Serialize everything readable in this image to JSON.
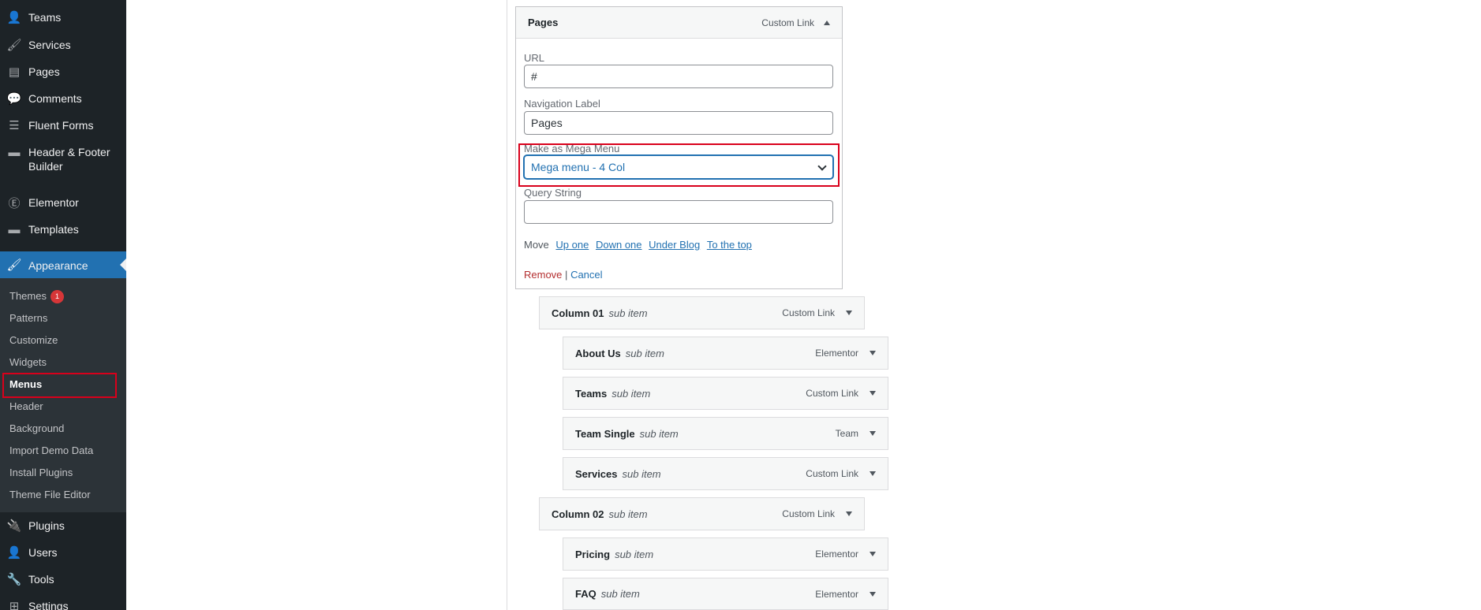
{
  "sidebar": {
    "top_items": [
      {
        "label": "Teams",
        "icon": "person-icon",
        "glyph": "👤"
      },
      {
        "label": "Services",
        "icon": "brush-icon",
        "glyph": "🖌"
      },
      {
        "label": "Pages",
        "icon": "pages-icon",
        "glyph": "▤"
      },
      {
        "label": "Comments",
        "icon": "comment-icon",
        "glyph": "💬"
      },
      {
        "label": "Fluent Forms",
        "icon": "forms-icon",
        "glyph": "☰"
      },
      {
        "label": "Header & Footer Builder",
        "icon": "folder-icon",
        "glyph": "▬"
      },
      {
        "label": "Elementor",
        "icon": "elementor-icon",
        "glyph": "Ⓔ"
      },
      {
        "label": "Templates",
        "icon": "folder-icon",
        "glyph": "▬"
      }
    ],
    "appearance": {
      "label": "Appearance",
      "icon": "paintbrush-icon",
      "glyph": "🖌"
    },
    "submenu": [
      {
        "label": "Themes",
        "badge": "1"
      },
      {
        "label": "Patterns"
      },
      {
        "label": "Customize"
      },
      {
        "label": "Widgets"
      },
      {
        "label": "Menus"
      },
      {
        "label": "Header"
      },
      {
        "label": "Background"
      },
      {
        "label": "Import Demo Data"
      },
      {
        "label": "Install Plugins"
      },
      {
        "label": "Theme File Editor"
      }
    ],
    "bottom_items": [
      {
        "label": "Plugins",
        "icon": "plugin-icon",
        "glyph": "🔌"
      },
      {
        "label": "Users",
        "icon": "person-icon",
        "glyph": "👤"
      },
      {
        "label": "Tools",
        "icon": "wrench-icon",
        "glyph": "🔧"
      },
      {
        "label": "Settings",
        "icon": "settings-icon",
        "glyph": "⊞"
      }
    ]
  },
  "menu_item": {
    "title": "Pages",
    "type": "Custom Link",
    "url_label": "URL",
    "url_value": "#",
    "nav_label": "Navigation Label",
    "nav_value": "Pages",
    "mega_label": "Make as Mega Menu",
    "mega_value": "Mega menu - 4 Col",
    "query_label": "Query String",
    "query_value": "",
    "move_label": "Move",
    "move_links": [
      "Up one",
      "Down one",
      "Under Blog",
      "To the top"
    ],
    "remove": "Remove",
    "separator": "|",
    "cancel": "Cancel"
  },
  "sub_rows": [
    {
      "title": "Column 01",
      "sub": "sub item",
      "type": "Custom Link"
    },
    {
      "title": "About Us",
      "sub": "sub item",
      "type": "Elementor"
    },
    {
      "title": "Teams",
      "sub": "sub item",
      "type": "Custom Link"
    },
    {
      "title": "Team Single",
      "sub": "sub item",
      "type": "Team"
    },
    {
      "title": "Services",
      "sub": "sub item",
      "type": "Custom Link"
    },
    {
      "title": "Column 02",
      "sub": "sub item",
      "type": "Custom Link"
    },
    {
      "title": "Pricing",
      "sub": "sub item",
      "type": "Elementor"
    },
    {
      "title": "FAQ",
      "sub": "sub item",
      "type": "Elementor"
    }
  ],
  "colors": {
    "sidebar_bg": "#1d2327",
    "accent": "#2271b1",
    "highlight": "#d9001b"
  }
}
